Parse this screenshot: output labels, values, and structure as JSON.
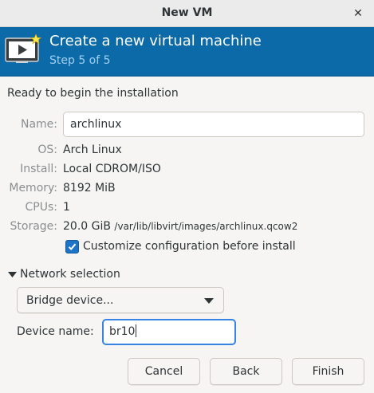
{
  "window": {
    "title": "New VM",
    "close_icon": "close-icon"
  },
  "banner": {
    "icon": "vm-monitor-icon",
    "title": "Create a new virtual machine",
    "step": "Step 5 of 5",
    "background_color": "#0d6aa8"
  },
  "summary": {
    "heading": "Ready to begin the installation",
    "name_label": "Name:",
    "name_value": "archlinux",
    "os_label": "OS:",
    "os_value": "Arch Linux",
    "install_label": "Install:",
    "install_value": "Local CDROM/ISO",
    "memory_label": "Memory:",
    "memory_value": "8192 MiB",
    "cpus_label": "CPUs:",
    "cpus_value": "1",
    "storage_label": "Storage:",
    "storage_size": "20.0 GiB",
    "storage_path": "/var/lib/libvirt/images/archlinux.qcow2"
  },
  "customize": {
    "label": "Customize configuration before install",
    "checked": true
  },
  "network": {
    "expander_label": "Network selection",
    "expanded": true,
    "dropdown_value": "Bridge device...",
    "device_name_label": "Device name:",
    "device_name_value": "br10"
  },
  "buttons": {
    "cancel": "Cancel",
    "back": "Back",
    "finish": "Finish"
  }
}
